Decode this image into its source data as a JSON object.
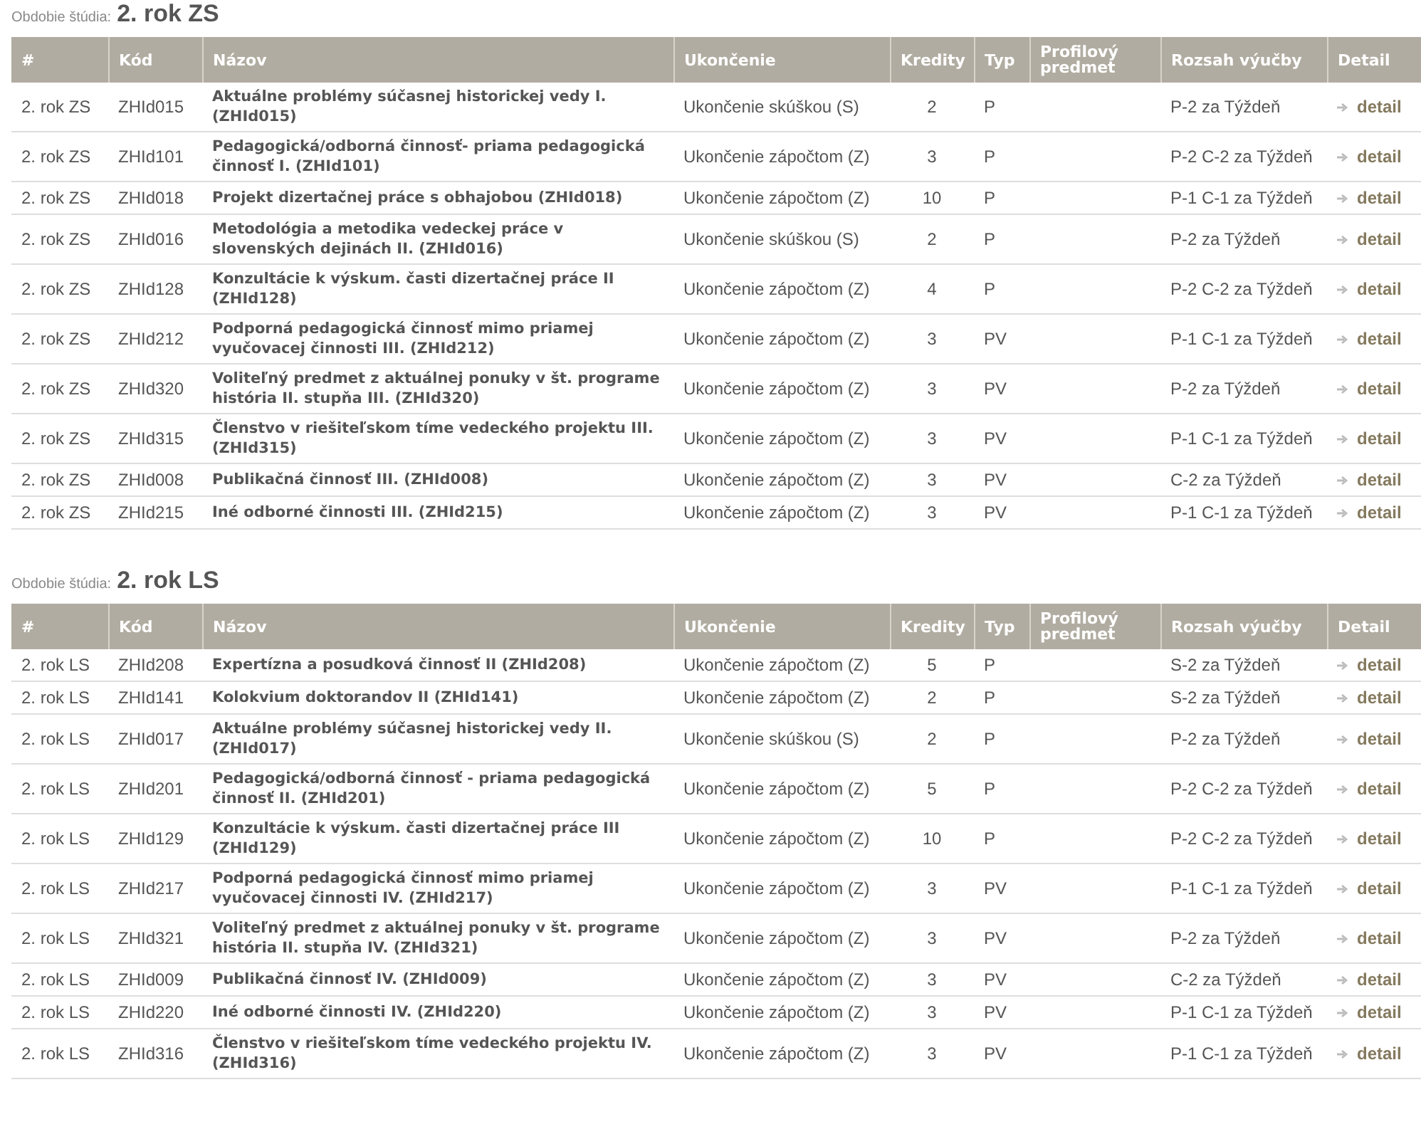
{
  "sections": [
    {
      "label": "Obdobie štúdia:",
      "period": "2. rok ZS",
      "columns": [
        "#",
        "Kód",
        "Názov",
        "Ukončenie",
        "Kredity",
        "Typ",
        "Profilový predmet",
        "Rozsah výučby",
        "Detail"
      ],
      "rows": [
        {
          "period": "2. rok ZS",
          "code": "ZHId015",
          "name": "Aktuálne problémy súčasnej historickej vedy I. (ZHId015)",
          "completion": "Ukončenie skúškou (S)",
          "credits": "2",
          "type": "P",
          "range": "P-2 za Týždeň",
          "detail": "detail"
        },
        {
          "period": "2. rok ZS",
          "code": "ZHId101",
          "name": "Pedagogická/odborná činnosť- priama pedagogická činnosť I. (ZHId101)",
          "completion": "Ukončenie zápočtom (Z)",
          "credits": "3",
          "type": "P",
          "range": "P-2 C-2 za Týždeň",
          "detail": "detail"
        },
        {
          "period": "2. rok ZS",
          "code": "ZHId018",
          "name": "Projekt dizertačnej práce s obhajobou (ZHId018)",
          "completion": "Ukončenie zápočtom (Z)",
          "credits": "10",
          "type": "P",
          "range": "P-1 C-1 za Týždeň",
          "detail": "detail"
        },
        {
          "period": "2. rok ZS",
          "code": "ZHId016",
          "name": "Metodológia a metodika vedeckej práce v slovenských dejinách II. (ZHId016)",
          "completion": "Ukončenie skúškou (S)",
          "credits": "2",
          "type": "P",
          "range": "P-2 za Týždeň",
          "detail": "detail"
        },
        {
          "period": "2. rok ZS",
          "code": "ZHId128",
          "name": "Konzultácie k výskum. časti dizertačnej práce II (ZHId128)",
          "completion": "Ukončenie zápočtom (Z)",
          "credits": "4",
          "type": "P",
          "range": "P-2 C-2 za Týždeň",
          "detail": "detail"
        },
        {
          "period": "2. rok ZS",
          "code": "ZHId212",
          "name": "Podporná pedagogická činnosť mimo priamej vyučovacej činnosti III. (ZHId212)",
          "completion": "Ukončenie zápočtom (Z)",
          "credits": "3",
          "type": "PV",
          "range": "P-1 C-1 za Týždeň",
          "detail": "detail"
        },
        {
          "period": "2. rok ZS",
          "code": "ZHId320",
          "name": "Voliteľný predmet z aktuálnej ponuky v št. programe história II. stupňa III. (ZHId320)",
          "completion": "Ukončenie zápočtom (Z)",
          "credits": "3",
          "type": "PV",
          "range": "P-2 za Týždeň",
          "detail": "detail"
        },
        {
          "period": "2. rok ZS",
          "code": "ZHId315",
          "name": "Členstvo v riešiteľskom tíme vedeckého projektu III. (ZHId315)",
          "completion": "Ukončenie zápočtom (Z)",
          "credits": "3",
          "type": "PV",
          "range": "P-1 C-1 za Týždeň",
          "detail": "detail"
        },
        {
          "period": "2. rok ZS",
          "code": "ZHId008",
          "name": "Publikačná činnosť III. (ZHId008)",
          "completion": "Ukončenie zápočtom (Z)",
          "credits": "3",
          "type": "PV",
          "range": "C-2 za Týždeň",
          "detail": "detail"
        },
        {
          "period": "2. rok ZS",
          "code": "ZHId215",
          "name": "Iné odborné činnosti III. (ZHId215)",
          "completion": "Ukončenie zápočtom (Z)",
          "credits": "3",
          "type": "PV",
          "range": "P-1 C-1 za Týždeň",
          "detail": "detail"
        }
      ]
    },
    {
      "label": "Obdobie štúdia:",
      "period": "2. rok LS",
      "columns": [
        "#",
        "Kód",
        "Názov",
        "Ukončenie",
        "Kredity",
        "Typ",
        "Profilový predmet",
        "Rozsah výučby",
        "Detail"
      ],
      "rows": [
        {
          "period": "2. rok LS",
          "code": "ZHId208",
          "name": "Expertízna a posudková činnosť II (ZHId208)",
          "completion": "Ukončenie zápočtom (Z)",
          "credits": "5",
          "type": "P",
          "range": "S-2 za Týždeň",
          "detail": "detail"
        },
        {
          "period": "2. rok LS",
          "code": "ZHId141",
          "name": "Kolokvium doktorandov II (ZHId141)",
          "completion": "Ukončenie zápočtom (Z)",
          "credits": "2",
          "type": "P",
          "range": "S-2 za Týždeň",
          "detail": "detail"
        },
        {
          "period": "2. rok LS",
          "code": "ZHId017",
          "name": "Aktuálne problémy súčasnej historickej vedy II. (ZHId017)",
          "completion": "Ukončenie skúškou (S)",
          "credits": "2",
          "type": "P",
          "range": "P-2 za Týždeň",
          "detail": "detail"
        },
        {
          "period": "2. rok LS",
          "code": "ZHId201",
          "name": "Pedagogická/odborná činnosť - priama pedagogická činnosť II. (ZHId201)",
          "completion": "Ukončenie zápočtom (Z)",
          "credits": "5",
          "type": "P",
          "range": "P-2 C-2 za Týždeň",
          "detail": "detail"
        },
        {
          "period": "2. rok LS",
          "code": "ZHId129",
          "name": "Konzultácie k výskum. časti dizertačnej práce III (ZHId129)",
          "completion": "Ukončenie zápočtom (Z)",
          "credits": "10",
          "type": "P",
          "range": "P-2 C-2 za Týždeň",
          "detail": "detail"
        },
        {
          "period": "2. rok LS",
          "code": "ZHId217",
          "name": "Podporná pedagogická činnosť mimo priamej vyučovacej činnosti IV. (ZHId217)",
          "completion": "Ukončenie zápočtom (Z)",
          "credits": "3",
          "type": "PV",
          "range": "P-1 C-1 za Týždeň",
          "detail": "detail"
        },
        {
          "period": "2. rok LS",
          "code": "ZHId321",
          "name": "Voliteľný predmet z aktuálnej ponuky v št. programe história II. stupňa IV. (ZHId321)",
          "completion": "Ukončenie zápočtom (Z)",
          "credits": "3",
          "type": "PV",
          "range": "P-2 za Týždeň",
          "detail": "detail"
        },
        {
          "period": "2. rok LS",
          "code": "ZHId009",
          "name": "Publikačná činnosť IV. (ZHId009)",
          "completion": "Ukončenie zápočtom (Z)",
          "credits": "3",
          "type": "PV",
          "range": "C-2 za Týždeň",
          "detail": "detail"
        },
        {
          "period": "2. rok LS",
          "code": "ZHId220",
          "name": "Iné odborné činnosti IV. (ZHId220)",
          "completion": "Ukončenie zápočtom (Z)",
          "credits": "3",
          "type": "PV",
          "range": "P-1 C-1 za Týždeň",
          "detail": "detail"
        },
        {
          "period": "2. rok LS",
          "code": "ZHId316",
          "name": "Členstvo v riešiteľskom tíme vedeckého projektu IV. (ZHId316)",
          "completion": "Ukončenie zápočtom (Z)",
          "credits": "3",
          "type": "PV",
          "range": "P-1 C-1 za Týždeň",
          "detail": "detail"
        }
      ]
    }
  ]
}
